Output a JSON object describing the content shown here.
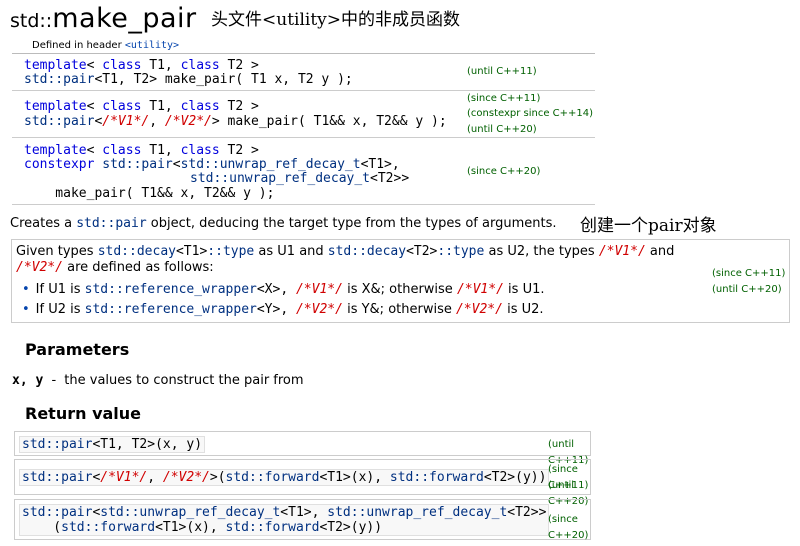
{
  "title": {
    "prefix": "std::",
    "name": "make_pair"
  },
  "annotation_header": "头文件<utility>中的非成员函数",
  "annotation_create": "创建一个pair对象",
  "header": {
    "label": "Defined in header",
    "file": "<utility>"
  },
  "decl1": {
    "l1_kw1": "template",
    "l1_mid": "< ",
    "l1_kw2": "class",
    "l1_t1": " T1, ",
    "l1_kw3": "class",
    "l1_t2": " T2 >",
    "l2_ns": "std::pair",
    "l2_rest": "<T1, T2> make_pair( T1 x, T2 y );",
    "ver": "(until C++11)"
  },
  "decl2": {
    "l1_kw1": "template",
    "l1_mid": "< ",
    "l1_kw2": "class",
    "l1_t1": " T1, ",
    "l1_kw3": "class",
    "l1_t2": " T2 >",
    "l2_ns": "std::pair",
    "l2_a": "<",
    "l2_v1": "/*V1*/",
    "l2_b": ", ",
    "l2_v2": "/*V2*/",
    "l2_c": "> make_pair( T1&& x, T2&& y );",
    "ver1": "(since C++11)",
    "ver2": "(constexpr since C++14)",
    "ver3": "(until C++20)"
  },
  "decl3": {
    "l1_kw1": "template",
    "l1_mid": "< ",
    "l1_kw2": "class",
    "l1_t1": " T1, ",
    "l1_kw3": "class",
    "l1_t2": " T2 >",
    "l2_kw": "constexpr",
    "l2_ns": " std::pair",
    "l2_a": "<",
    "l2_unwrap1": "std::unwrap_ref_decay_t",
    "l2_b": "<T1>,",
    "l3_unwrap2": "std::unwrap_ref_decay_t",
    "l3_b": "<T2>>",
    "l4": "    make_pair( T1&& x, T2&& y );",
    "ver": "(since C++20)"
  },
  "description": {
    "a": "Creates a ",
    "code": "std::pair",
    "b": " object, deducing the target type from the types of arguments."
  },
  "box": {
    "l1_a": "Given types ",
    "l1_c1": "std::decay",
    "l1_b": "<T1>",
    "l1_c2": "::type",
    "l1_d": " as U1 and ",
    "l1_c3": "std::decay",
    "l1_e": "<T2>",
    "l1_c4": "::type",
    "l1_f": " as U2, the types ",
    "l1_v1": "/*V1*/",
    "l1_g": " and",
    "l2_v2": "/*V2*/",
    "l2_a": " are defined as follows:",
    "b1_a": "If U1 is ",
    "b1_code": "std::reference_wrapper",
    "b1_b": "<X>, ",
    "b1_v1": "/*V1*/",
    "b1_c": " is X&; otherwise ",
    "b1_v1b": "/*V1*/",
    "b1_d": " is U1.",
    "b2_a": "If U2 is ",
    "b2_code": "std::reference_wrapper",
    "b2_b": "<Y>, ",
    "b2_v2": "/*V2*/",
    "b2_c": " is Y&; otherwise ",
    "b2_v2b": "/*V2*/",
    "b2_d": " is U2.",
    "ver1": "(since C++11)",
    "ver2": "(until C++20)"
  },
  "parameters": {
    "heading": "Parameters",
    "name": "x, y",
    "dash": " - ",
    "desc": "the values to construct the pair from"
  },
  "return": {
    "heading": "Return value",
    "r1_ns": "std::pair",
    "r1_rest": "<T1, T2>(x, y)",
    "r1_ver": "(until C++11)",
    "r2_ns": "std::pair",
    "r2_a": "<",
    "r2_v1": "/*V1*/",
    "r2_b": ", ",
    "r2_v2": "/*V2*/",
    "r2_c": ">(",
    "r2_f1": "std::forward",
    "r2_d": "<T1>(x), ",
    "r2_f2": "std::forward",
    "r2_e": "<T2>(y))",
    "r2_ver1": "(since C++11)",
    "r2_ver2": "(until C++20)",
    "r3_ns": "std::pair",
    "r3_a": "<",
    "r3_u1": "std::unwrap_ref_decay_t",
    "r3_b": "<T1>, ",
    "r3_u2": "std::unwrap_ref_decay_t",
    "r3_c": "<T2>>",
    "r3_l2a": "    (",
    "r3_f1": "std::forward",
    "r3_l2b": "<T1>(x), ",
    "r3_f2": "std::forward",
    "r3_l2c": "<T2>(y))",
    "r3_ver": "(since C++20)"
  }
}
